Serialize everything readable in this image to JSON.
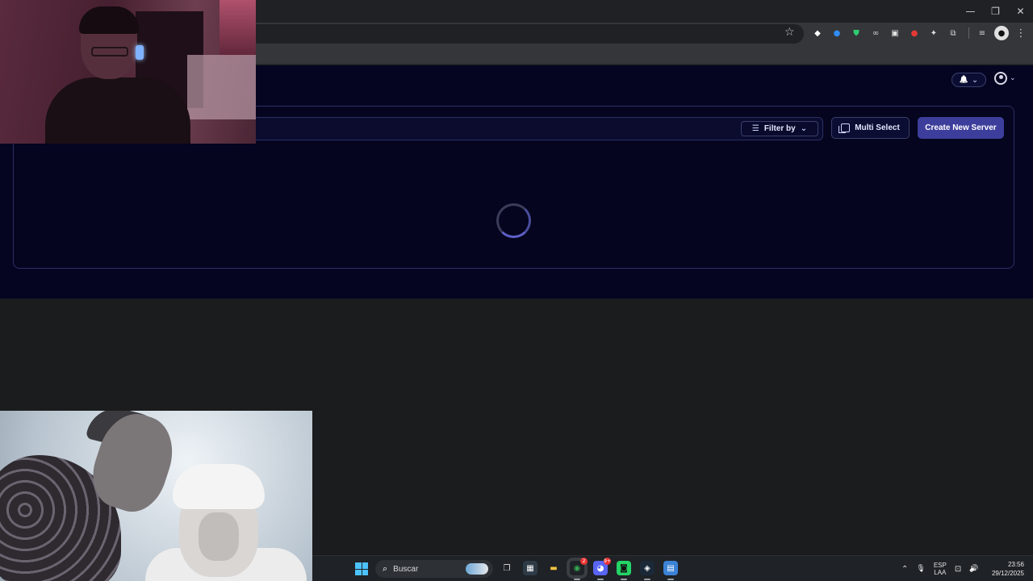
{
  "browser": {
    "window_controls": {
      "minimize": "—",
      "restore": "❐",
      "close": "✕"
    },
    "extensions": [
      {
        "name": "ext-diamond-icon",
        "glyph": "◆",
        "color": "#ffffff",
        "bg": "transparent"
      },
      {
        "name": "ext-blue-icon",
        "glyph": "●",
        "color": "#2f8df5",
        "bg": "transparent"
      },
      {
        "name": "ext-shield-icon",
        "glyph": "⛊",
        "color": "#2ecc71",
        "bg": "transparent"
      },
      {
        "name": "ext-glasses-icon",
        "glyph": "∞",
        "color": "#d0d0d0",
        "bg": "transparent"
      },
      {
        "name": "ext-box-icon",
        "glyph": "▣",
        "color": "#e0e0e0",
        "bg": "transparent"
      },
      {
        "name": "ext-red-icon",
        "glyph": "●",
        "color": "#e53935",
        "bg": "transparent"
      },
      {
        "name": "ext-gear-icon",
        "glyph": "✦",
        "color": "#e0e0e0",
        "bg": "transparent"
      },
      {
        "name": "extensions-puzzle-icon",
        "glyph": "⧉",
        "color": "#d0d0d0",
        "bg": "transparent"
      }
    ],
    "toolbar_right": {
      "reading_list_icon": "≡",
      "profile_glyph": "●",
      "menu_icon": "⋮"
    },
    "star_icon": "☆"
  },
  "header": {
    "bell_icon": "🔔",
    "chevron_icon": "⌄"
  },
  "toolbar": {
    "filter_label": "Filter by",
    "multi_select_label": "Multi Select",
    "create_server_label": "Create New Server"
  },
  "taskbar": {
    "search_label": "Buscar",
    "apps": [
      {
        "name": "task-view-icon",
        "glyph": "❐",
        "color": "#e0e0e0",
        "bg": "transparent",
        "active": false
      },
      {
        "name": "store-icon",
        "glyph": "▦",
        "color": "#ffffff",
        "bg": "#2f3a47",
        "active": false
      },
      {
        "name": "file-explorer-icon",
        "glyph": "▬",
        "color": "#f4c542",
        "bg": "transparent",
        "active": false
      },
      {
        "name": "chrome-icon",
        "glyph": "◉",
        "color": "#34a853",
        "bg": "transparent",
        "active": true,
        "selected": true,
        "badge": "2"
      },
      {
        "name": "discord-icon",
        "glyph": "◕",
        "color": "#ffffff",
        "bg": "#5865f2",
        "active": true,
        "badge": "9+"
      },
      {
        "name": "whatsapp-icon",
        "glyph": "◙",
        "color": "#111111",
        "bg": "#25d366",
        "active": true
      },
      {
        "name": "steam-icon",
        "glyph": "◈",
        "color": "#ffffff",
        "bg": "#1b2838",
        "active": true
      },
      {
        "name": "notepad-icon",
        "glyph": "▤",
        "color": "#ffffff",
        "bg": "#3b82d6",
        "active": true
      }
    ],
    "tray": {
      "chevron_up": "⌃",
      "mic_icon": "🎙",
      "language_top": "ESP",
      "language_bottom": "LAA",
      "network_icon": "⊡",
      "volume_icon": "🔊"
    },
    "time": "23:56",
    "date": "29/12/2025"
  }
}
